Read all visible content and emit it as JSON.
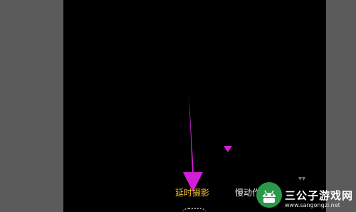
{
  "camera": {
    "modes": {
      "timelapse": "延时摄影",
      "slowmo_partial": "慢动作"
    }
  },
  "annotation": {
    "color": "#d21fd6"
  },
  "watermark": {
    "title": "三公子游戏网",
    "url": "www.sangongzi.net",
    "badge_color": "#2a9a4a"
  }
}
